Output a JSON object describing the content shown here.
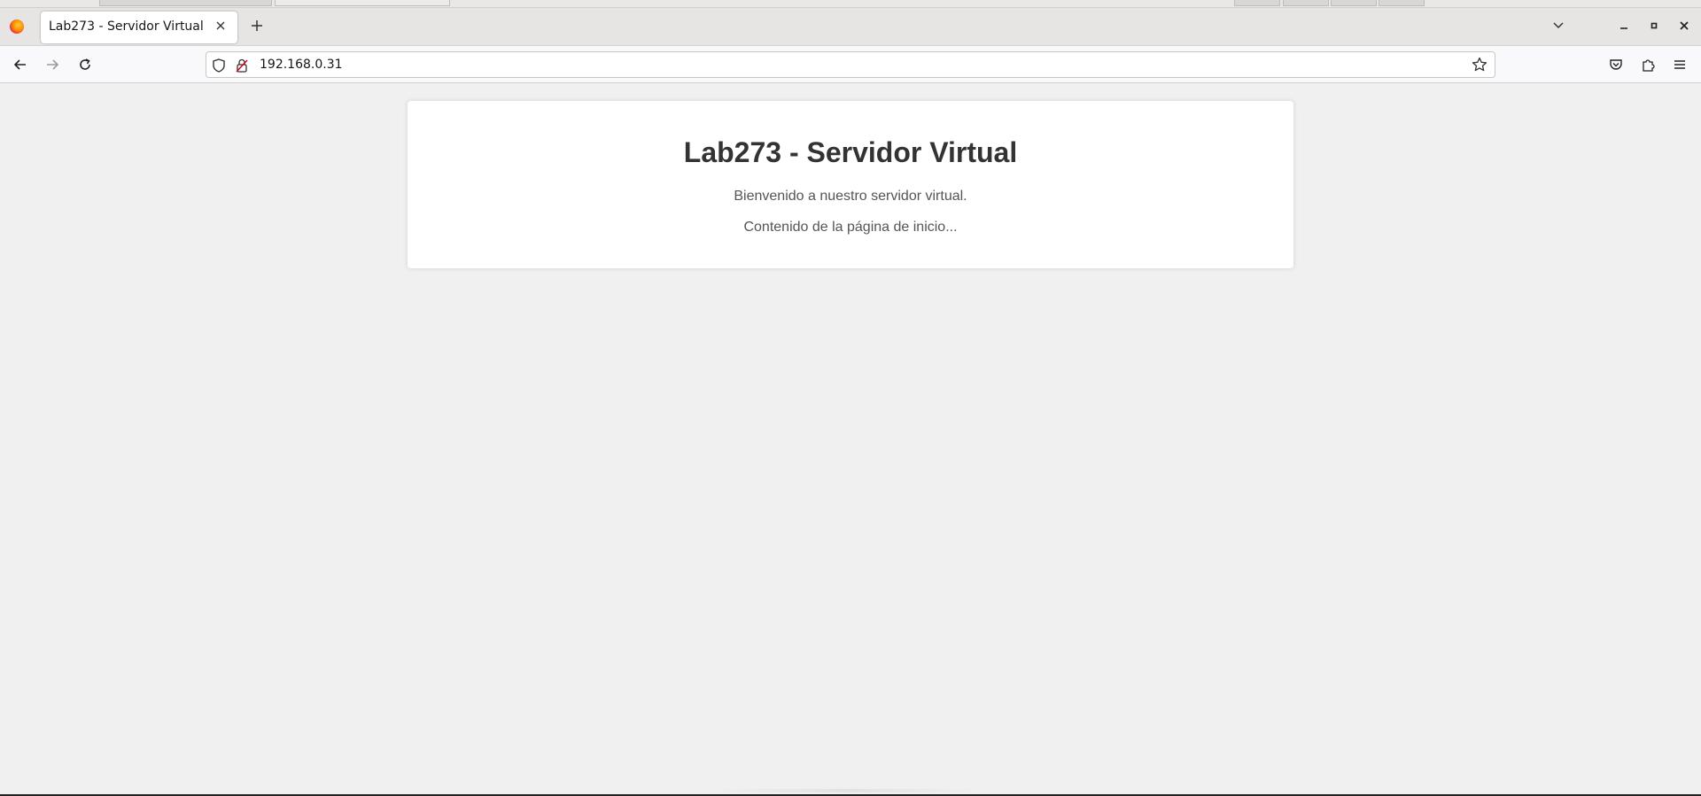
{
  "browser": {
    "tab_title": "Lab273 - Servidor Virtual",
    "url": "192.168.0.31"
  },
  "page": {
    "heading": "Lab273 - Servidor Virtual",
    "welcome": "Bienvenido a nuestro servidor virtual.",
    "content": "Contenido de la página de inicio..."
  },
  "colors": {
    "page_background": "#f0f0f0",
    "card_background": "#ffffff",
    "heading": "#333333",
    "text": "#555555"
  }
}
